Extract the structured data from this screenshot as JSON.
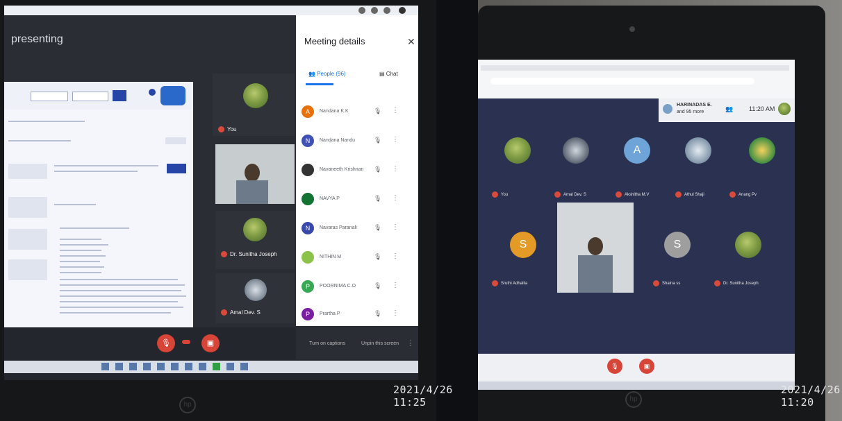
{
  "left_photo": {
    "timestamp": "2021/4/26  11:25",
    "screen": {
      "header": "presenting",
      "panel_title": "Meeting details",
      "people_tab": "People (96)",
      "chat_tab": "Chat",
      "participants": [
        {
          "initial": "A",
          "name": "Nandana K.K",
          "color": "#e8710a"
        },
        {
          "initial": "N",
          "name": "Nandana Nandu",
          "color": "#3f51b5"
        },
        {
          "initial": "",
          "name": "Navaneeth Krishnan",
          "color": "#333333"
        },
        {
          "initial": "",
          "name": "NAVYA P",
          "color": "#137333"
        },
        {
          "initial": "N",
          "name": "Navaras Paranali",
          "color": "#3949ab"
        },
        {
          "initial": "",
          "name": "NITHIN M",
          "color": "#8bc34a"
        },
        {
          "initial": "P",
          "name": "POORNIMA C.O",
          "color": "#34a853"
        },
        {
          "initial": "P",
          "name": "Prartha P",
          "color": "#7b1fa2"
        }
      ],
      "tiles": [
        {
          "name": "You"
        },
        {
          "name": ""
        },
        {
          "name": "Dr. Sunitha Joseph"
        },
        {
          "name": "Amal Dev. S"
        }
      ],
      "bottom_actions": [
        "Turn on captions",
        "Unpin this screen"
      ]
    },
    "brand_logo": "hp"
  },
  "right_photo": {
    "timestamp": "2021/4/26  11:20",
    "screen": {
      "header_name": "HARINADAS E.",
      "header_sub": "and 95 more",
      "clock": "11:20 AM",
      "tiles": [
        {
          "name": "You",
          "type": "leaf"
        },
        {
          "name": "Amal Dev. S",
          "type": "photo"
        },
        {
          "name": "Akshitha M.V",
          "type": "letter",
          "letter": "A",
          "color": "#6fa4d8"
        },
        {
          "name": "Athul Shaji",
          "type": "photo2"
        },
        {
          "name": "Anang Pv",
          "type": "photo3"
        },
        {
          "name": "Sruthi Adhalila",
          "type": "letter",
          "letter": "S",
          "color": "#e39a26"
        },
        {
          "name": "",
          "type": "video"
        },
        {
          "name": "Shalna ss",
          "type": "letter",
          "letter": "S",
          "color": "#9e9e9e"
        },
        {
          "name": "Dr. Sunitha Joseph",
          "type": "leaf"
        }
      ]
    },
    "brand_logo": "hp"
  }
}
